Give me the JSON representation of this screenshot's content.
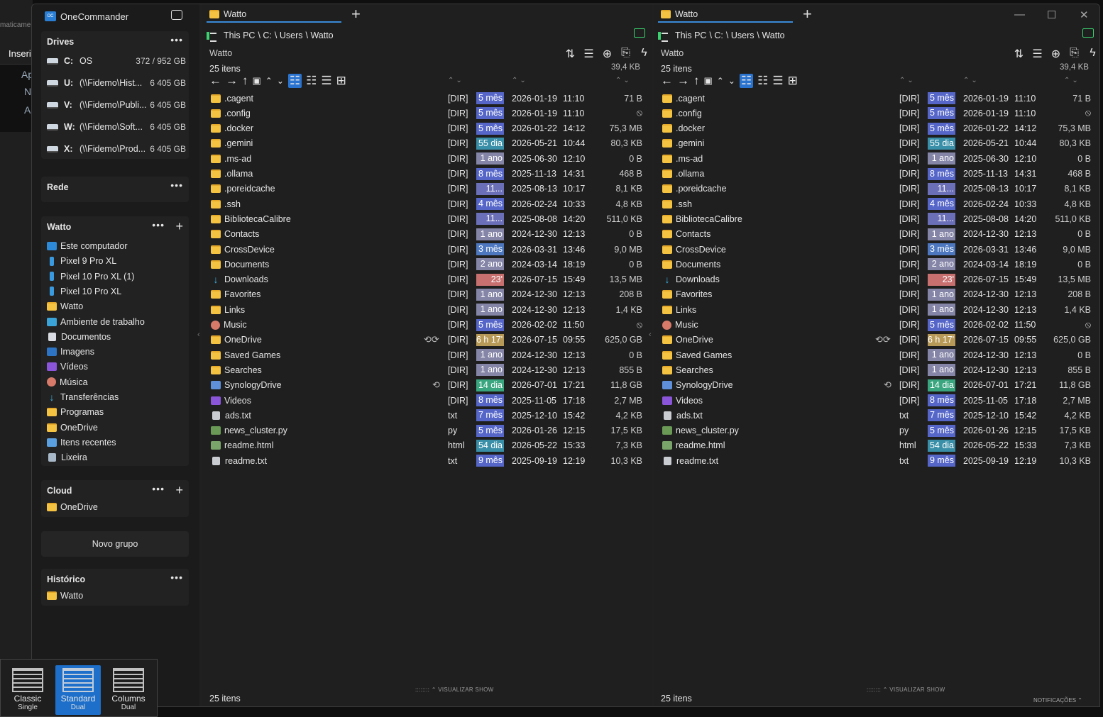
{
  "app": {
    "title": "OneCommander"
  },
  "background": {
    "text1": "maticame",
    "text2": "Inseri",
    "strip": [
      "Ap",
      "N",
      "A"
    ]
  },
  "drives": {
    "header": "Drives",
    "items": [
      {
        "letter": "C:",
        "name": "OS",
        "size": "372 / 952 GB"
      },
      {
        "letter": "U:",
        "name": "(\\\\Fidemo\\Hist...",
        "size": "6 405 GB"
      },
      {
        "letter": "V:",
        "name": "(\\\\Fidemo\\Publi...",
        "size": "6 405 GB"
      },
      {
        "letter": "W:",
        "name": "(\\\\Fidemo\\Soft...",
        "size": "6 405 GB"
      },
      {
        "letter": "X:",
        "name": "(\\\\Fidemo\\Prod...",
        "size": "6 405 GB"
      }
    ]
  },
  "rede": {
    "header": "Rede"
  },
  "favorites": {
    "header": "Watto",
    "items": [
      {
        "label": "Este computador",
        "icon": "pc"
      },
      {
        "label": "Pixel 9 Pro XL",
        "icon": "phone"
      },
      {
        "label": "Pixel 10 Pro XL (1)",
        "icon": "phone"
      },
      {
        "label": "Pixel 10 Pro XL",
        "icon": "phone"
      },
      {
        "label": "Watto",
        "icon": "folder"
      },
      {
        "label": "Ambiente de trabalho",
        "icon": "desk"
      },
      {
        "label": "Documentos",
        "icon": "doc"
      },
      {
        "label": "Imagens",
        "icon": "img"
      },
      {
        "label": "Vídeos",
        "icon": "vid"
      },
      {
        "label": "Música",
        "icon": "music"
      },
      {
        "label": "Transferências",
        "icon": "dl"
      },
      {
        "label": "Programas",
        "icon": "folder"
      },
      {
        "label": "OneDrive",
        "icon": "folder"
      },
      {
        "label": "Itens recentes",
        "icon": "rec"
      },
      {
        "label": "Lixeira",
        "icon": "bin"
      }
    ]
  },
  "cloud": {
    "header": "Cloud",
    "items": [
      {
        "label": "OneDrive"
      }
    ]
  },
  "novo_grupo": "Novo grupo",
  "historico": {
    "header": "Histórico",
    "items": [
      {
        "label": "Watto"
      }
    ]
  },
  "pane": {
    "tab": "Watto",
    "breadcrumb": [
      "This PC",
      "\\ C:",
      "\\ Users",
      "\\ Watto"
    ],
    "name": "Watto",
    "count": "25 itens",
    "size": "39,4 KB",
    "footer": "25 itens",
    "visualizar": "VISUALIZAR SHOW",
    "files": [
      {
        "name": ".cagent",
        "icon": "folder",
        "ext": "[DIR]",
        "age": "5 mês",
        "agecolor": "#5566c8",
        "date": "2026-01-19",
        "time": "11:10",
        "size": "71 B"
      },
      {
        "name": ".config",
        "icon": "folder",
        "ext": "[DIR]",
        "age": "5 mês",
        "agecolor": "#5566c8",
        "date": "2026-01-19",
        "time": "11:10",
        "size": "⦸"
      },
      {
        "name": ".docker",
        "icon": "folder",
        "ext": "[DIR]",
        "age": "5 mês",
        "agecolor": "#5566c8",
        "date": "2026-01-22",
        "time": "14:12",
        "size": "75,3 MB"
      },
      {
        "name": ".gemini",
        "icon": "folder",
        "ext": "[DIR]",
        "age": "55 dia",
        "agecolor": "#3a8fa8",
        "date": "2026-05-21",
        "time": "10:44",
        "size": "80,3 KB"
      },
      {
        "name": ".ms-ad",
        "icon": "folder",
        "ext": "[DIR]",
        "age": "1 ano",
        "agecolor": "#8585a8",
        "date": "2025-06-30",
        "time": "12:10",
        "size": "0 B"
      },
      {
        "name": ".ollama",
        "icon": "folder",
        "ext": "[DIR]",
        "age": "8 mês",
        "agecolor": "#5566c8",
        "date": "2025-11-13",
        "time": "14:31",
        "size": "468 B"
      },
      {
        "name": ".poreidcache",
        "icon": "folder",
        "ext": "[DIR]",
        "age": "11...",
        "agecolor": "#6b6fb8",
        "date": "2025-08-13",
        "time": "10:17",
        "size": "8,1 KB"
      },
      {
        "name": ".ssh",
        "icon": "folder",
        "ext": "[DIR]",
        "age": "4 mês",
        "agecolor": "#5566c8",
        "date": "2026-02-24",
        "time": "10:33",
        "size": "4,8 KB"
      },
      {
        "name": "BibliotecaCalibre",
        "icon": "folder",
        "ext": "[DIR]",
        "age": "11...",
        "agecolor": "#6b6fb8",
        "date": "2025-08-08",
        "time": "14:20",
        "size": "511,0 KB"
      },
      {
        "name": "Contacts",
        "icon": "folder",
        "ext": "[DIR]",
        "age": "1 ano",
        "agecolor": "#8585a8",
        "date": "2024-12-30",
        "time": "12:13",
        "size": "0 B"
      },
      {
        "name": "CrossDevice",
        "icon": "folder",
        "ext": "[DIR]",
        "age": "3 mês",
        "agecolor": "#4d78c0",
        "date": "2026-03-31",
        "time": "13:46",
        "size": "9,0 MB"
      },
      {
        "name": "Documents",
        "icon": "folder",
        "ext": "[DIR]",
        "age": "2 ano",
        "agecolor": "#8585a8",
        "date": "2024-03-14",
        "time": "18:19",
        "size": "0 B"
      },
      {
        "name": "Downloads",
        "icon": "dl",
        "ext": "[DIR]",
        "age": "23'",
        "agecolor": "#c87070",
        "date": "2026-07-15",
        "time": "15:49",
        "size": "13,5 MB"
      },
      {
        "name": "Favorites",
        "icon": "folder",
        "ext": "[DIR]",
        "age": "1 ano",
        "agecolor": "#8585a8",
        "date": "2024-12-30",
        "time": "12:13",
        "size": "208 B"
      },
      {
        "name": "Links",
        "icon": "folder",
        "ext": "[DIR]",
        "age": "1 ano",
        "agecolor": "#8585a8",
        "date": "2024-12-30",
        "time": "12:13",
        "size": "1,4 KB"
      },
      {
        "name": "Music",
        "icon": "music",
        "ext": "[DIR]",
        "age": "5 mês",
        "agecolor": "#5566c8",
        "date": "2026-02-02",
        "time": "11:50",
        "size": "⦸"
      },
      {
        "name": "OneDrive",
        "icon": "folder",
        "ext": "[DIR]",
        "age": "6 h 17'",
        "agecolor": "#b89a58",
        "date": "2026-07-15",
        "time": "09:55",
        "size": "625,0 GB",
        "sync": "⟲⟳"
      },
      {
        "name": "Saved Games",
        "icon": "folder",
        "ext": "[DIR]",
        "age": "1 ano",
        "agecolor": "#8585a8",
        "date": "2024-12-30",
        "time": "12:13",
        "size": "0 B"
      },
      {
        "name": "Searches",
        "icon": "folder",
        "ext": "[DIR]",
        "age": "1 ano",
        "agecolor": "#8585a8",
        "date": "2024-12-30",
        "time": "12:13",
        "size": "855 B"
      },
      {
        "name": "SynologyDrive",
        "icon": "syno",
        "ext": "[DIR]",
        "age": "14 dia",
        "agecolor": "#3aa680",
        "date": "2026-07-01",
        "time": "17:21",
        "size": "11,8 GB",
        "sync": "⟲"
      },
      {
        "name": "Videos",
        "icon": "vid",
        "ext": "[DIR]",
        "age": "8 mês",
        "agecolor": "#5566c8",
        "date": "2025-11-05",
        "time": "17:18",
        "size": "2,7 MB"
      },
      {
        "name": "ads.txt",
        "icon": "txt",
        "ext": "txt",
        "age": "7 mês",
        "agecolor": "#5566c8",
        "date": "2025-12-10",
        "time": "15:42",
        "size": "4,2 KB"
      },
      {
        "name": "news_cluster.py",
        "icon": "py",
        "ext": "py",
        "age": "5 mês",
        "agecolor": "#5566c8",
        "date": "2026-01-26",
        "time": "12:15",
        "size": "17,5 KB"
      },
      {
        "name": "readme.html",
        "icon": "html",
        "ext": "html",
        "age": "54 dia",
        "agecolor": "#3a8fa8",
        "date": "2026-05-22",
        "time": "15:33",
        "size": "7,3 KB"
      },
      {
        "name": "readme.txt",
        "icon": "txt",
        "ext": "txt",
        "age": "9 mês",
        "agecolor": "#5566c8",
        "date": "2025-09-19",
        "time": "12:19",
        "size": "10,3 KB"
      }
    ]
  },
  "notificacoes": "NOTIFICAÇÕES",
  "layouts": [
    {
      "label": "Classic",
      "sub": "Single",
      "selected": false
    },
    {
      "label": "Standard",
      "sub": "Dual",
      "selected": true
    },
    {
      "label": "Columns",
      "sub": "Dual",
      "selected": false
    }
  ],
  "window_controls": [
    "—",
    "☐",
    "✕"
  ]
}
